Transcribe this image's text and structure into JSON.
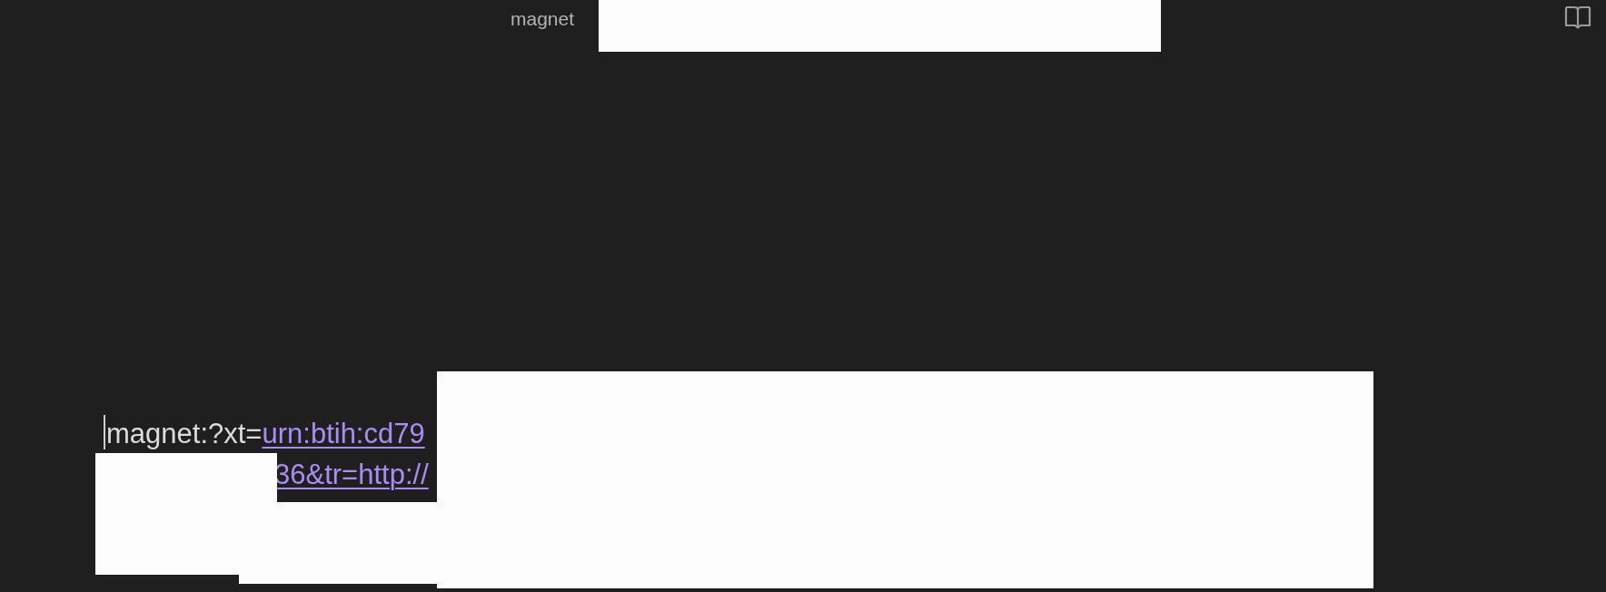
{
  "title": "magnet",
  "editor": {
    "caret": true,
    "lines": [
      {
        "segments": [
          {
            "kind": "plain",
            "text": "magnet:?xt="
          },
          {
            "kind": "link",
            "text": "urn:btih:cd79"
          }
        ]
      },
      {
        "segments": [
          {
            "kind": "link",
            "text": "36&tr=http://"
          }
        ]
      }
    ]
  }
}
